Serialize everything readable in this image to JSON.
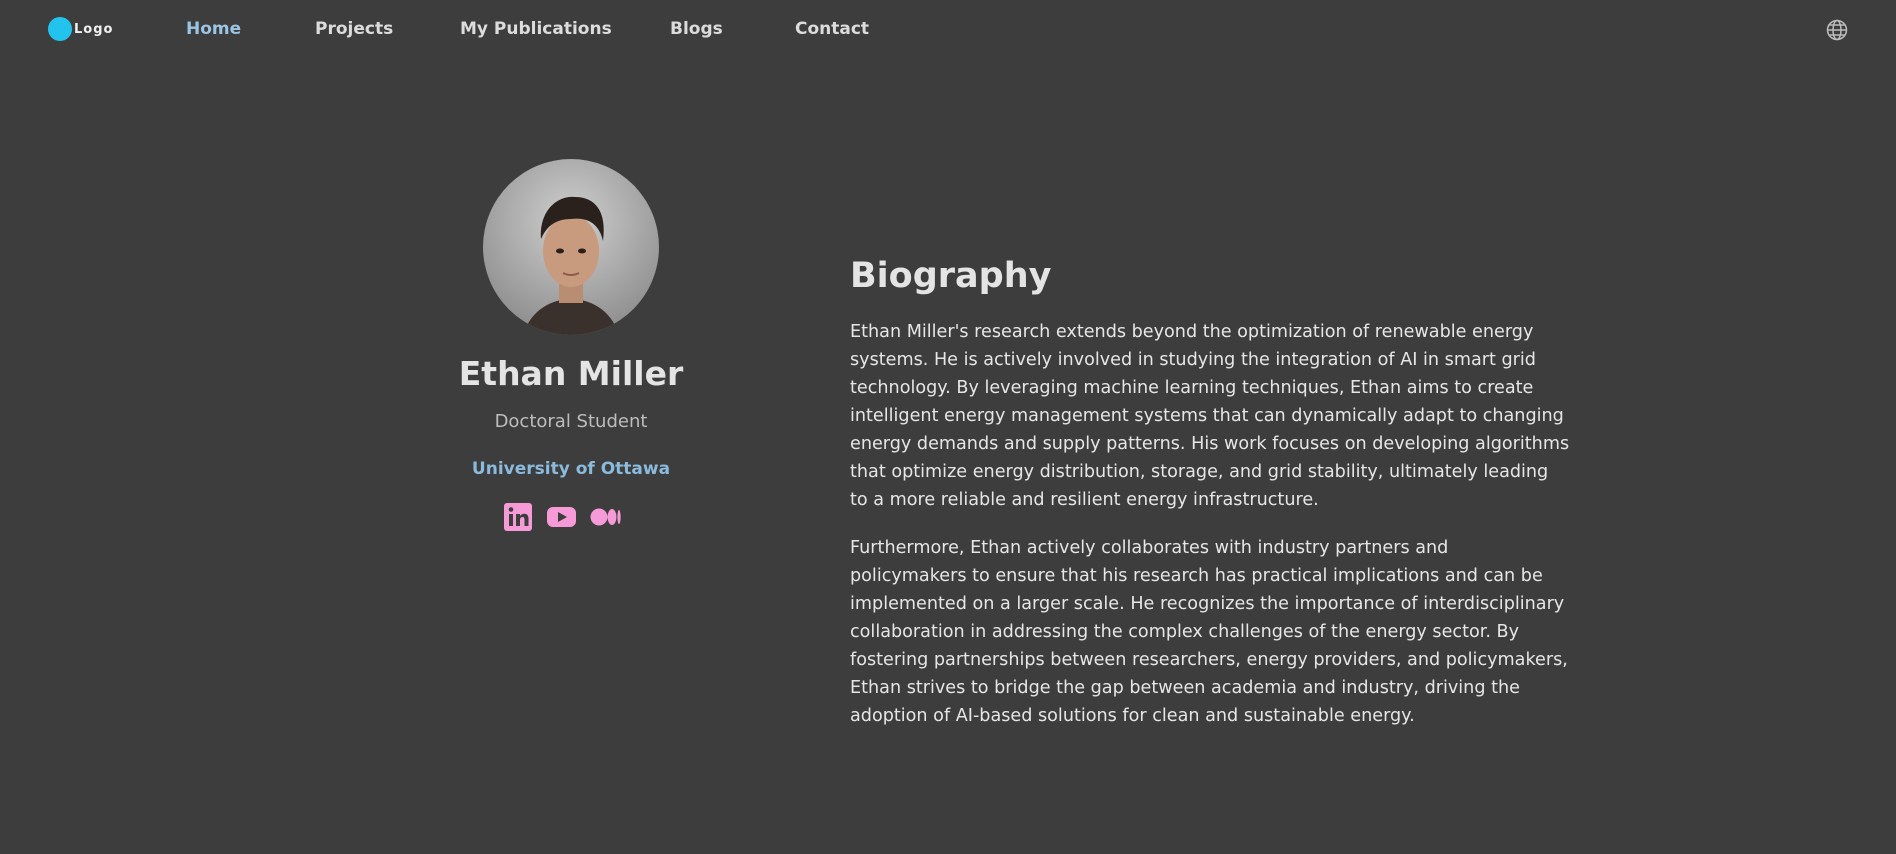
{
  "nav": {
    "logo_text": "Logo",
    "links": [
      {
        "label": "Home",
        "active": true
      },
      {
        "label": "Projects",
        "active": false
      },
      {
        "label": "My Publications",
        "active": false
      },
      {
        "label": "Blogs",
        "active": false
      },
      {
        "label": "Contact",
        "active": false
      }
    ],
    "language_icon": "globe-icon"
  },
  "profile": {
    "name": "Ethan Miller",
    "role": "Doctoral Student",
    "university": "University of Ottawa",
    "socials": [
      {
        "icon": "linkedin-icon"
      },
      {
        "icon": "youtube-icon"
      },
      {
        "icon": "medium-icon"
      }
    ]
  },
  "biography": {
    "title": "Biography",
    "paragraphs": [
      "Ethan Miller's research extends beyond the optimization of renewable energy systems. He is actively involved in studying the integration of AI in smart grid technology. By leveraging machine learning techniques, Ethan aims to create intelligent energy management systems that can dynamically adapt to changing energy demands and supply patterns. His work focuses on developing algorithms that optimize energy distribution, storage, and grid stability, ultimately leading to a more reliable and resilient energy infrastructure.",
      "Furthermore, Ethan actively collaborates with industry partners and policymakers to ensure that his research has practical implications and can be implemented on a larger scale. He recognizes the importance of interdisciplinary collaboration in addressing the complex challenges of the energy sector. By fostering partnerships between researchers, energy providers, and policymakers, Ethan strives to bridge the gap between academia and industry, driving the adoption of AI-based solutions for clean and sustainable energy."
    ]
  },
  "colors": {
    "background": "#3d3d3d",
    "accent": "#8bbadd",
    "logo": "#22c4ee",
    "social": "#f79ad8"
  }
}
